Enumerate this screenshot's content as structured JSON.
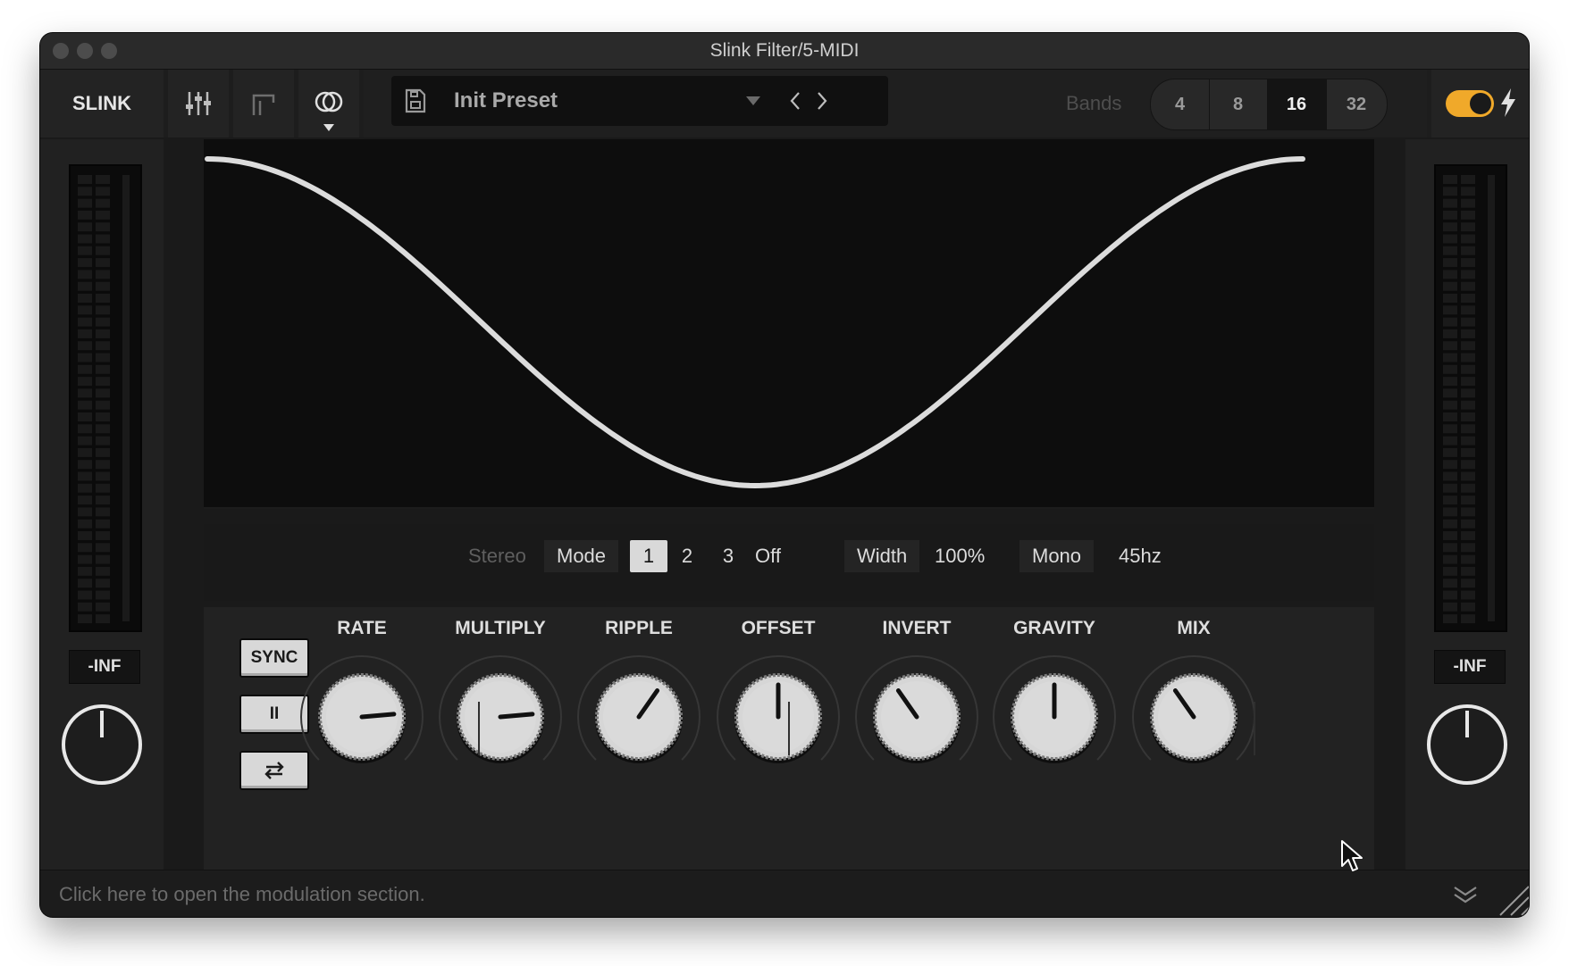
{
  "window": {
    "title": "Slink Filter/5-MIDI"
  },
  "toolbar": {
    "brand": "SLINK",
    "preset_name": "Init Preset",
    "bands_label": "Bands",
    "bands": [
      "4",
      "8",
      "16",
      "32"
    ],
    "bands_selected": "16",
    "power_on": true
  },
  "meters": {
    "left_label": "-INF",
    "right_label": "-INF"
  },
  "stereo": {
    "stereo_label": "Stereo",
    "mode_label": "Mode",
    "modes": [
      "1",
      "2",
      "3",
      "Off"
    ],
    "mode_selected": "1",
    "width_label": "Width",
    "width_value": "100%",
    "mono_label": "Mono",
    "mono_value": "45hz"
  },
  "transport": {
    "sync_label": "SYNC",
    "pause_label": "II",
    "swap_label": "⇄"
  },
  "knobs": [
    {
      "label": "RATE",
      "angle_deg": -95
    },
    {
      "label": "MULTIPLY",
      "angle_deg": -95
    },
    {
      "label": "RIPPLE",
      "angle_deg": -145
    },
    {
      "label": "OFFSET",
      "angle_deg": 180
    },
    {
      "label": "INVERT",
      "angle_deg": 145
    },
    {
      "label": "GRAVITY",
      "angle_deg": 180
    },
    {
      "label": "MIX",
      "angle_deg": 145
    }
  ],
  "status": {
    "text": "Click here to open the modulation section."
  },
  "colors": {
    "accent": "#f0a92a",
    "curve": "#dcdcdc",
    "background": "#1a1a1a"
  }
}
